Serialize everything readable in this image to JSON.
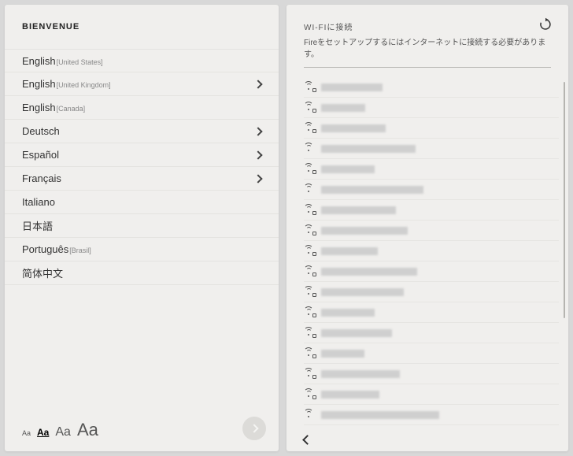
{
  "left": {
    "title": "BIENVENUE",
    "languages": [
      {
        "name": "English",
        "region": "[United States]",
        "expandable": false
      },
      {
        "name": "English",
        "region": "[United Kingdom]",
        "expandable": true
      },
      {
        "name": "English",
        "region": "[Canada]",
        "expandable": false
      },
      {
        "name": "Deutsch",
        "region": "",
        "expandable": true
      },
      {
        "name": "Español",
        "region": "",
        "expandable": true
      },
      {
        "name": "Français",
        "region": "",
        "expandable": true
      },
      {
        "name": "Italiano",
        "region": "",
        "expandable": false
      },
      {
        "name": "日本語",
        "region": "",
        "expandable": false
      },
      {
        "name": "Português",
        "region": "[Brasil]",
        "expandable": false
      },
      {
        "name": "简体中文",
        "region": "",
        "expandable": false
      }
    ],
    "fontSizes": {
      "label": "Aa",
      "selectedIndex": 1
    }
  },
  "right": {
    "title": "WI-FIに接続",
    "subtitle": "Fireをセットアップするにはインターネットに接続する必要があります。",
    "networks": [
      {
        "locked": true,
        "w": 78
      },
      {
        "locked": true,
        "w": 56
      },
      {
        "locked": true,
        "w": 82
      },
      {
        "locked": false,
        "w": 120
      },
      {
        "locked": true,
        "w": 68
      },
      {
        "locked": false,
        "w": 130
      },
      {
        "locked": true,
        "w": 95
      },
      {
        "locked": true,
        "w": 110
      },
      {
        "locked": true,
        "w": 72
      },
      {
        "locked": true,
        "w": 122
      },
      {
        "locked": true,
        "w": 105
      },
      {
        "locked": true,
        "w": 68
      },
      {
        "locked": true,
        "w": 90
      },
      {
        "locked": true,
        "w": 55
      },
      {
        "locked": true,
        "w": 100
      },
      {
        "locked": true,
        "w": 74
      },
      {
        "locked": false,
        "w": 150
      }
    ]
  }
}
